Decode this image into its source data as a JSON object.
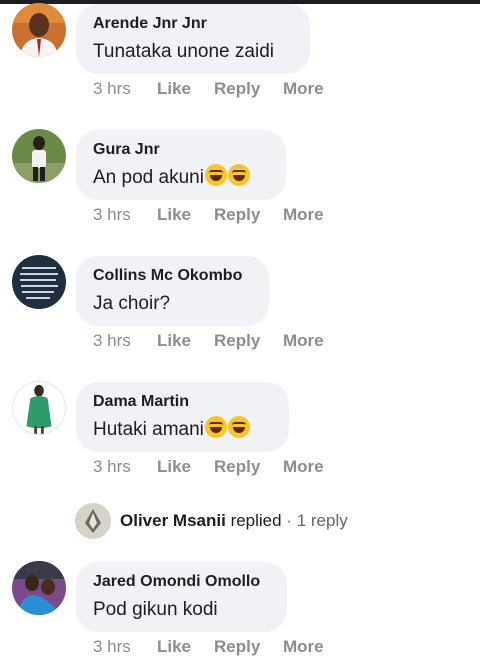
{
  "comments": [
    {
      "author": "Arende Jnr Jnr",
      "text": "Tunataka unone zaidi",
      "emojis": [],
      "time": "3 hrs",
      "like": "Like",
      "reply": "Reply",
      "more": "More"
    },
    {
      "author": "Gura Jnr",
      "text": "An pod akuni",
      "emojis": [
        "rolling-on-floor-laughing",
        "rolling-on-floor-laughing"
      ],
      "time": "3 hrs",
      "like": "Like",
      "reply": "Reply",
      "more": "More"
    },
    {
      "author": "Collins Mc Okombo",
      "text": "Ja choir?",
      "emojis": [],
      "time": "3 hrs",
      "like": "Like",
      "reply": "Reply",
      "more": "More"
    },
    {
      "author": "Dama Martin",
      "text": "Hutaki amani",
      "emojis": [
        "rolling-on-floor-laughing",
        "rolling-on-floor-laughing"
      ],
      "time": "3 hrs",
      "like": "Like",
      "reply": "Reply",
      "more": "More"
    },
    {
      "author": "Jared Omondi Omollo",
      "text": "Pod gikun kodi",
      "emojis": [],
      "time": "3 hrs",
      "like": "Like",
      "reply": "Reply",
      "more": "More"
    }
  ],
  "reply_summary": {
    "name": "Oliver Msanii",
    "verb": "replied",
    "separator": " · ",
    "count": "1 reply"
  },
  "colors": {
    "bubble": "#f0f2f5",
    "meta_text": "#8a8d91",
    "name_text": "#1c1e21"
  }
}
